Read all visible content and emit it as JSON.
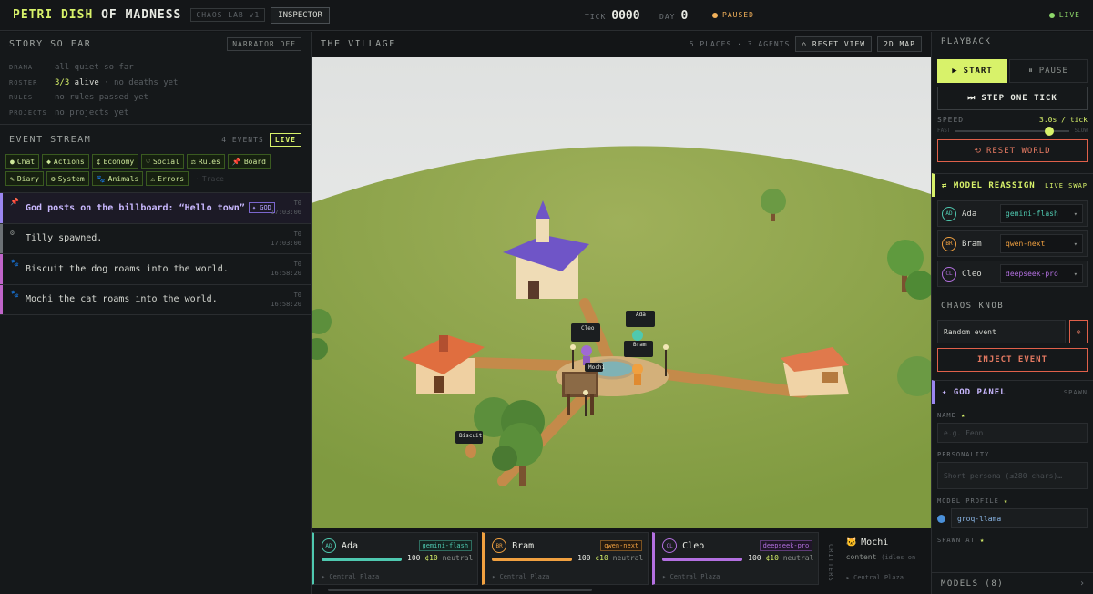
{
  "topbar": {
    "brand_a": "PETRI DISH",
    "brand_b": " OF MADNESS",
    "tag": "CHAOS LAB v1",
    "inspector": "INSPECTOR",
    "tick_label": "TICK",
    "tick_value": "0000",
    "day_label": "DAY",
    "day_value": "0",
    "status": "PAUSED",
    "live": "LIVE",
    "status_color": "#f2b15a",
    "live_color": "#8ed86a"
  },
  "story": {
    "title": "STORY SO FAR",
    "narrator_btn": "NARRATOR OFF",
    "rows": [
      {
        "key": "DRAMA",
        "value": "all quiet so far"
      },
      {
        "key": "ROSTER",
        "value": "3/3",
        "value2": " alive",
        "value3": " · no deaths yet"
      },
      {
        "key": "RULES",
        "value": "no rules passed yet"
      },
      {
        "key": "PROJECTS",
        "value": "no projects yet"
      }
    ]
  },
  "event_stream": {
    "title": "EVENT STREAM",
    "count": "4 EVENTS",
    "live_btn": "LIVE",
    "filters": [
      {
        "icon": "●",
        "label": "Chat"
      },
      {
        "icon": "◆",
        "label": "Actions"
      },
      {
        "icon": "¢",
        "label": "Economy"
      },
      {
        "icon": "♡",
        "label": "Social"
      },
      {
        "icon": "⚖",
        "label": "Rules"
      },
      {
        "icon": "📌",
        "label": "Board"
      },
      {
        "icon": "✎",
        "label": "Diary"
      },
      {
        "icon": "⚙",
        "label": "System"
      },
      {
        "icon": "🐾",
        "label": "Animals"
      },
      {
        "icon": "⚠",
        "label": "Errors"
      },
      {
        "icon": "·",
        "label": "Trace"
      }
    ],
    "events": [
      {
        "icon": "📌",
        "text": "God posts on the billboard: “Hello town”",
        "tag": "✦ GOD",
        "tick": "T0",
        "time": "17:03:06",
        "color": "#9b86f0"
      },
      {
        "icon": "⚙",
        "text": "Tilly spawned.",
        "tick": "T0",
        "time": "17:03:06",
        "color": "#6c7175"
      },
      {
        "icon": "🐾",
        "text": "Biscuit the dog roams into the world.",
        "tick": "T0",
        "time": "16:58:20",
        "color": "#c065c9"
      },
      {
        "icon": "🐾",
        "text": "Mochi the cat roams into the world.",
        "tick": "T0",
        "time": "16:58:20",
        "color": "#c065c9"
      }
    ]
  },
  "village": {
    "title": "THE VILLAGE",
    "summary": "5 PLACES · 3 AGENTS",
    "reset_view": "⌂ RESET VIEW",
    "map_btn": "2D MAP",
    "labels": {
      "cleo": "Cleo",
      "ada": "Ada",
      "bram": "Bram",
      "mochi": "Mochi",
      "biscuit": "Biscuit"
    }
  },
  "agents": [
    {
      "initials": "AD",
      "name": "Ada",
      "model": "gemini-flash",
      "hp": "100",
      "credits": "¢10",
      "mood": "neutral",
      "location": "▸ Central Plaza",
      "color": "#4fc9b0",
      "hp_fraction": 1.0
    },
    {
      "initials": "BR",
      "name": "Bram",
      "model": "qwen-next",
      "hp": "100",
      "credits": "¢10",
      "mood": "neutral",
      "location": "▸ Central Plaza",
      "color": "#f0a040",
      "hp_fraction": 1.0
    },
    {
      "initials": "CL",
      "name": "Cleo",
      "model": "deepseek-pro",
      "hp": "100",
      "credits": "¢10",
      "mood": "neutral",
      "location": "▸ Central Plaza",
      "color": "#b370e0",
      "hp_fraction": 1.0
    }
  ],
  "critters": {
    "label": "CRITTERS",
    "items": [
      {
        "icon": "🐱",
        "name": "Mochi",
        "status": "content",
        "extra": "(idles on",
        "location": "▸ Central Plaza"
      }
    ]
  },
  "playback": {
    "title": "PLAYBACK",
    "start": "START",
    "pause": "PAUSE",
    "step": "STEP ONE TICK",
    "speed_label": "SPEED",
    "speed_value": "3.0s / tick",
    "fast": "FAST",
    "slow": "SLOW",
    "speed_fraction": 0.83,
    "reset": "RESET WORLD"
  },
  "reassign": {
    "title": "⇄ MODEL REASSIGN",
    "subtitle": "LIVE SWAP",
    "rows": [
      {
        "initials": "AD",
        "name": "Ada",
        "model": "gemini-flash",
        "color": "#4fc9b0"
      },
      {
        "initials": "BR",
        "name": "Bram",
        "model": "qwen-next",
        "color": "#f0a040"
      },
      {
        "initials": "CL",
        "name": "Cleo",
        "model": "deepseek-pro",
        "color": "#b370e0"
      }
    ]
  },
  "chaos": {
    "title": "CHAOS KNOB",
    "select": "Random event",
    "inject": "INJECT EVENT"
  },
  "god_panel": {
    "title": "✦ GOD PANEL",
    "subtitle": "SPAWN",
    "name_label": "NAME",
    "name_placeholder": "e.g. Fenn",
    "personality_label": "PERSONALITY",
    "personality_placeholder": "Short persona (≤280 chars)…",
    "profile_label": "MODEL PROFILE",
    "profile_value": "groq-llama",
    "spawn_label": "SPAWN AT",
    "required": "★"
  },
  "models": {
    "title": "MODELS (8)",
    "arrow": "›"
  },
  "colors": {
    "accent": "#d8f26a",
    "danger": "#e57a62",
    "god": "#9b86f0"
  }
}
